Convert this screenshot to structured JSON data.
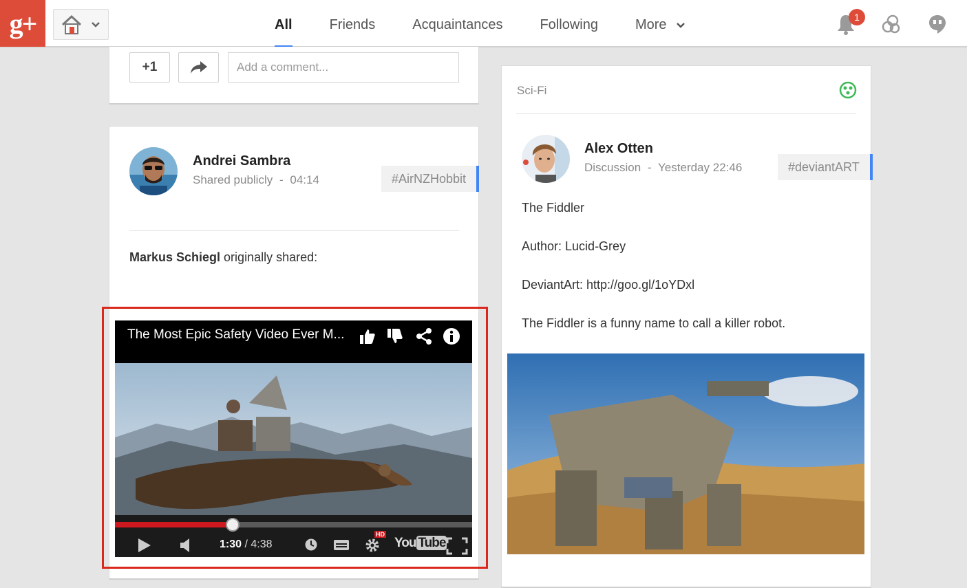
{
  "topbar": {
    "logo_text": "g+",
    "tabs": [
      {
        "label": "All",
        "active": true
      },
      {
        "label": "Friends"
      },
      {
        "label": "Acquaintances"
      },
      {
        "label": "Following"
      },
      {
        "label": "More"
      }
    ],
    "notification_count": "1",
    "icons": [
      "home-icon",
      "chevron-down-icon",
      "bell-icon",
      "circles-icon",
      "hangouts-icon"
    ]
  },
  "top_card": {
    "plus_one_label": "+1",
    "comment_placeholder": "Add a comment..."
  },
  "post_andrei": {
    "author": "Andrei Sambra",
    "visibility": "Shared publicly",
    "separator": "-",
    "time": "04:14",
    "hashtag": "#AirNZHobbit",
    "original_sharer": "Markus Schiegl",
    "shared_text": " originally shared:",
    "video": {
      "title": "The Most Epic Safety Video Ever M...",
      "current_time": "1:30",
      "duration": "4:38",
      "progress": 0.33,
      "hd_label": "HD",
      "brand_you": "You",
      "brand_tube": "Tube"
    }
  },
  "post_alex": {
    "community": "Sci-Fi",
    "author": "Alex Otten",
    "category": "Discussion",
    "separator": "-",
    "time": "Yesterday 22:46",
    "hashtag": "#deviantART",
    "lines": [
      "The Fiddler",
      "Author: Lucid-Grey",
      "DeviantArt: http://goo.gl/1oYDxl",
      "The Fiddler is a funny name to call a killer robot."
    ]
  },
  "colors": {
    "brand_red": "#dd4b39",
    "accent_blue": "#4285f4",
    "highlight_red": "#d9281c",
    "community_green": "#3cba54"
  }
}
